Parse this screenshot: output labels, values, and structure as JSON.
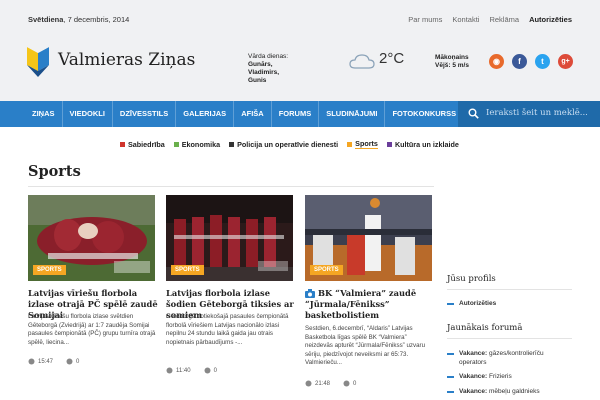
{
  "topbar": {
    "day": "Svētdiena",
    "date": ", 7 decembris, 2014",
    "links": [
      "Par mums",
      "Kontakti",
      "Reklāma"
    ],
    "login": "Autorizēties"
  },
  "header": {
    "site_name": "Valmieras Ziņas",
    "namedays_title": "Vārda dienas:",
    "namedays_names": [
      "Gunārs,",
      "Vladimirs,",
      "Gunis"
    ],
    "temperature": "2°C",
    "weather_condition": "Mākoņains",
    "wind": "Vējš: 5 m/s",
    "social": [
      {
        "icon": "rss-icon",
        "glyph": "◉",
        "color": "#e86a2c"
      },
      {
        "icon": "facebook-icon",
        "glyph": "f",
        "color": "#3b5998"
      },
      {
        "icon": "twitter-icon",
        "glyph": "t",
        "color": "#2aa3ef"
      },
      {
        "icon": "google-plus-icon",
        "glyph": "g+",
        "color": "#dd4b39"
      }
    ]
  },
  "nav": {
    "items": [
      "ZIŅAS",
      "VIEDOKLI",
      "DZĪVESSTILS",
      "GALERIJAS",
      "AFIŠA",
      "FORUMS",
      "SLUDINĀJUMI",
      "FOTOKONKURSS"
    ],
    "search_placeholder": "Ieraksti šeit un meklē..."
  },
  "subnav": [
    {
      "label": "Sabiedrība",
      "color": "#d0342c"
    },
    {
      "label": "Ekonomika",
      "color": "#6ab04c"
    },
    {
      "label": "Policija un operatīvie dienesti",
      "color": "#333333"
    },
    {
      "label": "Sports",
      "color": "#f5a623"
    },
    {
      "label": "Kultūra un izklaide",
      "color": "#6a3d9a"
    }
  ],
  "page_title": "Sports",
  "articles": [
    {
      "tag": "SPORTS",
      "title": "Latvijas vīriešu florbola izlase otrajā PČ spēlē zaudē Somijai",
      "excerpt": "Latvijas vīriešu florbola izlase svētdien Gēteborgā (Zviedrijā) ar 1:7 zaudēja Somijai pasaules čempionātā (PČ) grupu turnīra otrajā spēlē, liecina...",
      "time": "15:47",
      "comments": "0"
    },
    {
      "tag": "SPORTS",
      "title": "Latvijas florbola izlase šodien Gēteborgā tiksies ar somiem",
      "excerpt": "Gēteborgā notiekošajā pasaules čempionātā florbolā vīriešiem Latvijas nacionālo izlasi nepilnu 24 stundu laikā gaida jau otrais nopietnais pārbaudījums -...",
      "time": "11:40",
      "comments": "0"
    },
    {
      "tag": "SPORTS",
      "title": "BK “Valmiera” zaudē “Jūrmala/Fēnikss” basketbolistiem",
      "excerpt": "Sestdien, 6.decembrī, “Aldaris” Latvijas Basketbola līgas spēlē BK “Valmiera” neizdevās apturēt “Jūrmala/Fēnikss” uzvaru sēriju, piedzīvojot neveiksmi ar 65:73. Valmierieču...",
      "time": "21:48",
      "comments": "0"
    }
  ],
  "sidebar": {
    "profile_title": "Jūsu profils",
    "profile_link": "Autorizēties",
    "forum_title": "Jaunākais forumā",
    "forum_items": [
      {
        "label": "Vakance:",
        "text": "gāzes/kontrolierīču operators"
      },
      {
        "label": "Vakance:",
        "text": "Frizieris"
      },
      {
        "label": "Vakance:",
        "text": "mēbeļu galdnieks"
      }
    ]
  }
}
